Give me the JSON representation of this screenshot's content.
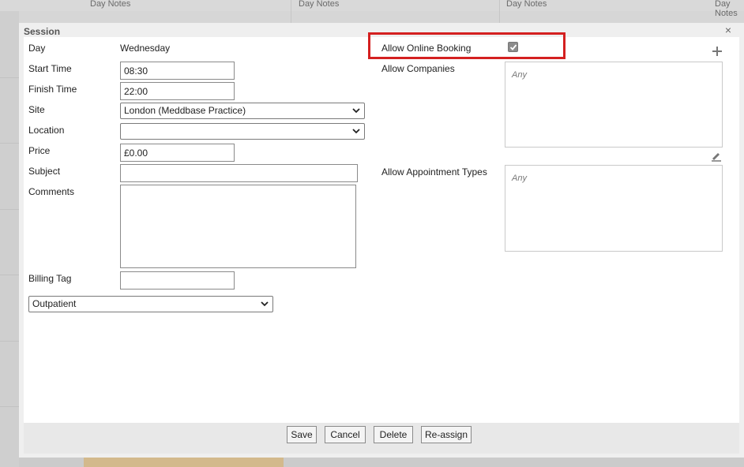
{
  "background": {
    "columns": [
      "Day Notes",
      "Day Notes",
      "Day Notes",
      "Day Notes"
    ]
  },
  "dialog": {
    "title": "Session",
    "close_label": "×"
  },
  "form": {
    "day_label": "Day",
    "day_value": "Wednesday",
    "start_time_label": "Start Time",
    "start_time_value": "08:30",
    "finish_time_label": "Finish Time",
    "finish_time_value": "22:00",
    "site_label": "Site",
    "site_value": "London (Meddbase Practice)",
    "location_label": "Location",
    "location_value": "",
    "price_label": "Price",
    "price_value": "£0.00",
    "subject_label": "Subject",
    "subject_value": "",
    "comments_label": "Comments",
    "comments_value": "",
    "billing_tag_label": "Billing Tag",
    "billing_tag_value": "",
    "type_value": "Outpatient"
  },
  "right": {
    "allow_online_booking_label": "Allow Online Booking",
    "allow_online_booking_checked": true,
    "allow_companies_label": "Allow Companies",
    "allow_companies_placeholder": "Any",
    "allow_appointment_types_label": "Allow Appointment Types",
    "allow_appointment_types_placeholder": "Any"
  },
  "footer": {
    "save": "Save",
    "cancel": "Cancel",
    "delete": "Delete",
    "reassign": "Re-assign"
  },
  "colors": {
    "highlight": "#d42020",
    "dialog_bg": "#efefef"
  }
}
